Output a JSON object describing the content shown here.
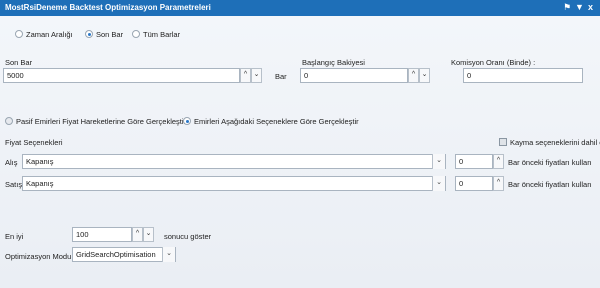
{
  "window": {
    "title": "MostRsiDeneme Backtest Optimizasyon Parametreleri",
    "pin_icon": "pin-icon",
    "menu_icon": "window-menu-icon",
    "close_label": "x"
  },
  "range": {
    "options": [
      "Zaman Aralığı",
      "Son Bar",
      "Tüm Barlar"
    ],
    "selected": "Son Bar"
  },
  "son_bar": {
    "label": "Son Bar",
    "value": "5000",
    "unit": "Bar"
  },
  "start_balance": {
    "label": "Başlangıç Bakiyesi",
    "value": "0"
  },
  "commission": {
    "label": "Komisyon Oranı (Binde) :",
    "value": "0"
  },
  "execution": {
    "options": [
      "Pasif Emirleri Fiyat Hareketlerine Göre Gerçekleştir",
      "Emirleri Aşağıdaki Seçeneklere Göre Gerçekleştir"
    ],
    "selected": "Emirleri Aşağıdaki Seçeneklere Göre Gerçekleştir"
  },
  "price_options": {
    "label": "Fiyat Seçenekleri",
    "slippage_label": "Kayma seçeneklerini dahil et",
    "slippage_checked": false,
    "buy": {
      "label": "Alış",
      "price": "Kapanış",
      "bars": "0",
      "suffix": "Bar önceki fiyatları kullan"
    },
    "sell": {
      "label": "Satış",
      "price": "Kapanış",
      "bars": "0",
      "suffix": "Bar önceki fiyatları kullan"
    }
  },
  "best": {
    "label": "En iyi",
    "value": "100",
    "suffix": "sonucu göster"
  },
  "optimization_mode": {
    "label": "Optimizasyon Modu",
    "value": "GridSearchOptimisation"
  },
  "colors": {
    "titlebar": "#1e6fb8",
    "accent": "#2a78c8"
  }
}
